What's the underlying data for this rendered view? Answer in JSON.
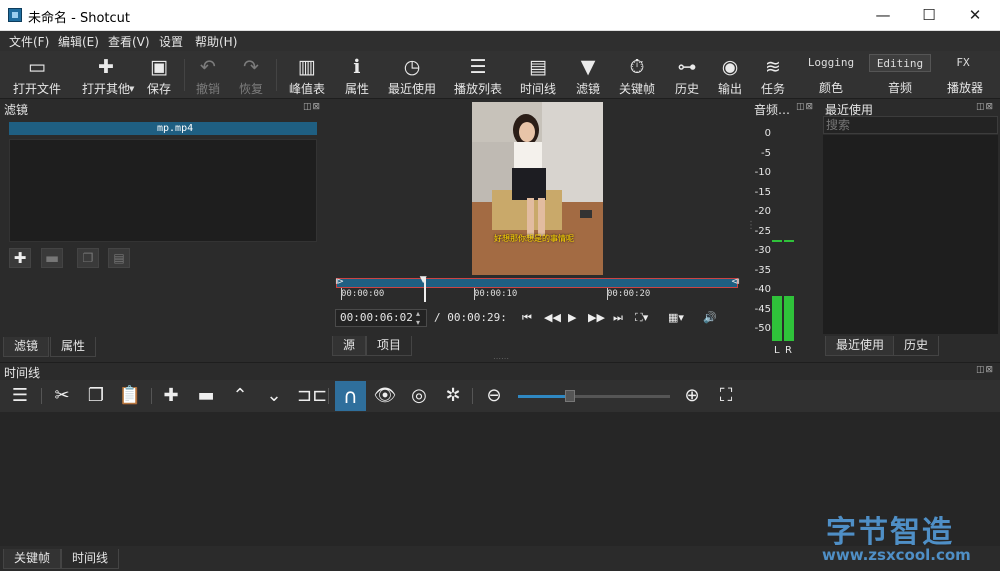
{
  "window": {
    "title": "未命名 - Shotcut",
    "minimize": "—",
    "maximize": "☐",
    "close": "✕"
  },
  "menu": [
    "文件(F)",
    "编辑(E)",
    "查看(V)",
    "设置",
    "帮助(H)"
  ],
  "toolbar": {
    "items": [
      {
        "label": "打开文件",
        "icon": "folder-open-icon",
        "glyph": "▭"
      },
      {
        "label": "打开其他",
        "icon": "open-other-icon",
        "glyph": "✚"
      },
      {
        "label": "保存",
        "icon": "save-icon",
        "glyph": "▣"
      },
      {
        "label": "撤销",
        "icon": "undo-icon",
        "glyph": "↶"
      },
      {
        "label": "恢复",
        "icon": "redo-icon",
        "glyph": "↷"
      },
      {
        "label": "峰值表",
        "icon": "peak-meter-icon",
        "glyph": "▥"
      },
      {
        "label": "属性",
        "icon": "properties-icon",
        "glyph": "ℹ"
      },
      {
        "label": "最近使用",
        "icon": "recent-icon",
        "glyph": "◷"
      },
      {
        "label": "播放列表",
        "icon": "playlist-icon",
        "glyph": "☰"
      },
      {
        "label": "时间线",
        "icon": "timeline-icon",
        "glyph": "▤"
      },
      {
        "label": "滤镜",
        "icon": "filter-icon",
        "glyph": "▼"
      },
      {
        "label": "关键帧",
        "icon": "keyframes-icon",
        "glyph": "⏱"
      },
      {
        "label": "历史",
        "icon": "history-icon",
        "glyph": "⊶"
      },
      {
        "label": "输出",
        "icon": "export-icon",
        "glyph": "◉"
      },
      {
        "label": "任务",
        "icon": "jobs-icon",
        "glyph": "≋"
      }
    ],
    "modes": [
      {
        "label": "Logging",
        "sub": "颜色"
      },
      {
        "label": "Editing",
        "sub": "音频"
      },
      {
        "label": "FX",
        "sub": "播放器"
      }
    ]
  },
  "filters_panel": {
    "title": "滤镜",
    "clip_name": "mp.mp4",
    "tabs": [
      "滤镜",
      "属性"
    ]
  },
  "player": {
    "subtitle": "好想那你想是的事情呢",
    "ruler": [
      "00:00:00",
      "00:00:10",
      "00:00:20"
    ],
    "current_time": "00:00:06:02",
    "total_time": "/ 00:00:29:",
    "playhead_fraction": 0.21,
    "tabs": [
      "源",
      "项目"
    ]
  },
  "audio_meter": {
    "title": "音频…",
    "scale": [
      "0",
      "-5",
      "-10",
      "-15",
      "-20",
      "-25",
      "-30",
      "-35",
      "-40",
      "-45",
      "-50"
    ],
    "channels": [
      "L",
      "R"
    ]
  },
  "recent_panel": {
    "title": "最近使用",
    "search_placeholder": "搜索",
    "tabs": [
      "最近使用",
      "历史"
    ]
  },
  "timeline_panel": {
    "title": "时间线",
    "zoom_fraction": 0.34,
    "tabs": [
      "关键帧",
      "时间线"
    ]
  },
  "watermark": {
    "text_cn": "字节智造",
    "url": "www.zsxcool.com"
  },
  "colors": {
    "accent": "#1f5f82",
    "snap_active": "#2f6f9c",
    "meter_green": "#2fc23a"
  }
}
